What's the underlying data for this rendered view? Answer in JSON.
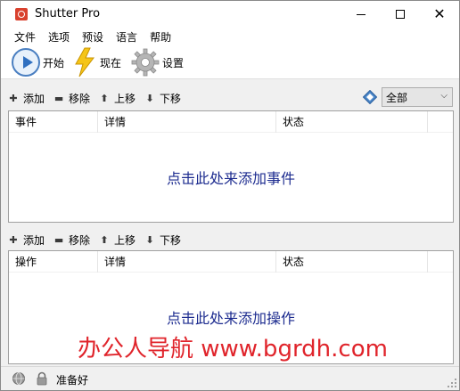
{
  "window": {
    "title": "Shutter Pro",
    "minimize_glyph": "",
    "maximize_glyph": "",
    "close_glyph": "✕"
  },
  "menu": [
    "文件",
    "选项",
    "预设",
    "语言",
    "帮助"
  ],
  "toolbar": {
    "start_label": "开始",
    "now_label": "现在",
    "settings_label": "设置"
  },
  "events_section": {
    "add_label": "添加",
    "remove_label": "移除",
    "up_label": "上移",
    "down_label": "下移",
    "filter_value": "全部",
    "columns": [
      "事件",
      "详情",
      "状态",
      ""
    ],
    "empty_hint": "点击此处来添加事件"
  },
  "actions_section": {
    "add_label": "添加",
    "remove_label": "移除",
    "up_label": "上移",
    "down_label": "下移",
    "columns": [
      "操作",
      "详情",
      "状态",
      ""
    ],
    "empty_hint": "点击此处来添加操作"
  },
  "watermark": "办公人导航 www.bgrdh.com",
  "status": {
    "text": "准备好"
  },
  "icons": {
    "app": "shutter-app-icon",
    "start": "play-icon",
    "now": "lightning-bolt-icon",
    "settings": "gear-icon",
    "add": "plus-icon",
    "remove": "minus-icon",
    "up": "arrow-up-icon",
    "down": "arrow-down-icon",
    "filter": "filter-diamond-icon",
    "globe": "globe-icon",
    "lock": "lock-icon"
  },
  "colors": {
    "hint_text": "#1c2b8f",
    "watermark": "#e0242b",
    "app_icon": "#d9412e",
    "accent_blue": "#2f6fc0",
    "bolt_yellow": "#f5c518"
  }
}
